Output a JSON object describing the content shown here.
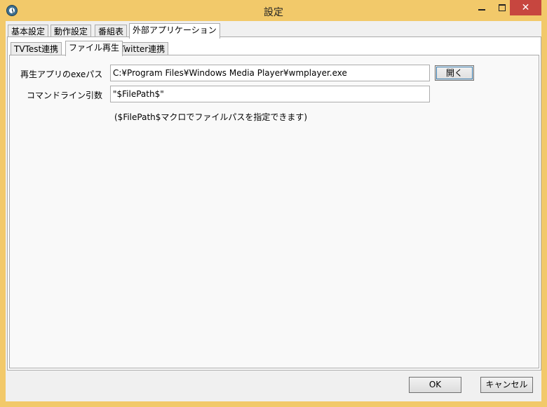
{
  "window": {
    "title": "設定"
  },
  "tabs": [
    "基本設定",
    "動作設定",
    "番組表",
    "外部アプリケーション"
  ],
  "subtabs": [
    "TVTest連携",
    "ファイル再生",
    "Twitter連携"
  ],
  "form": {
    "exe_label": "再生アプリのexeパス",
    "exe_value": "C:¥Program Files¥Windows Media Player¥wmplayer.exe",
    "open_label": "開く",
    "args_label": "コマンドライン引数",
    "args_value": "\"$FilePath$\"",
    "note": "($FilePath$マクロでファイルパスを指定できます)"
  },
  "footer": {
    "ok_label": "OK",
    "cancel_label": "キャンセル"
  },
  "colors": {
    "frame": "#f2c96a",
    "close_button": "#c7463f"
  },
  "icons": [
    "app-icon",
    "minimize-icon",
    "maximize-icon",
    "close-icon"
  ]
}
